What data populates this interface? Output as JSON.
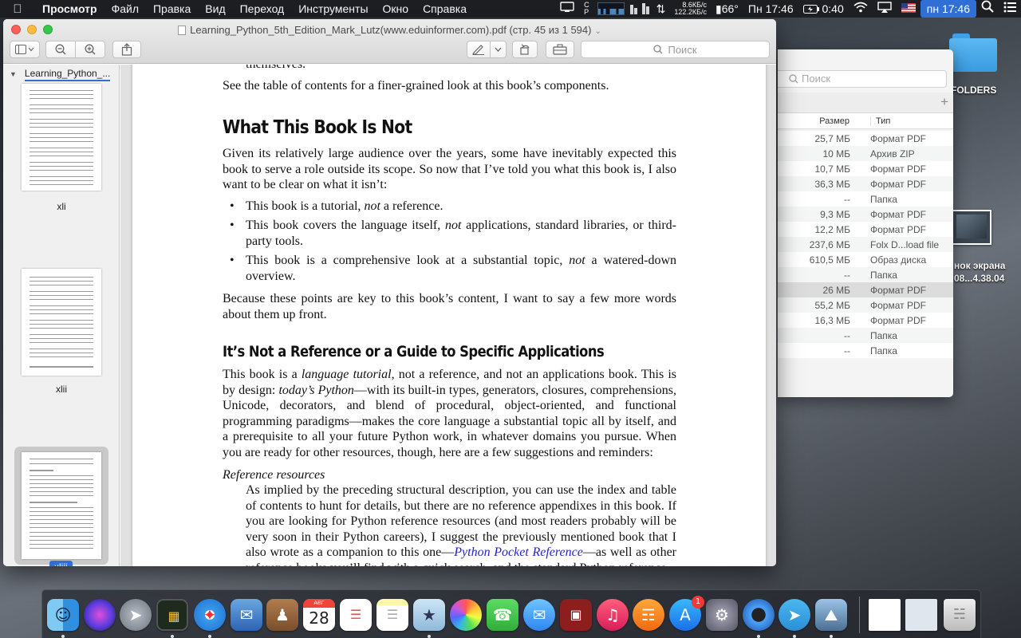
{
  "menubar": {
    "apple_icon": "apple-icon",
    "app_name": "Просмотр",
    "menus": [
      "Файл",
      "Правка",
      "Вид",
      "Переход",
      "Инструменты",
      "Окно",
      "Справка"
    ],
    "net_up": "8.6КБ/с",
    "net_down": "122.2КБ/с",
    "temperature": "66°",
    "clock_short": "Пн 17:46",
    "battery_time": "0:40",
    "clock_highlight": "пн 17:46"
  },
  "preview": {
    "title": "Learning_Python_5th_Edition_Mark_Lutz(www.eduinformer.com).pdf (стр. 45 из 1 594)",
    "search_placeholder": "Поиск",
    "sidebar": {
      "doc_name": "Learning_Python_...",
      "pages": [
        "xli",
        "xlii",
        "xliii"
      ],
      "selected_page": "xliii"
    },
    "page": {
      "top_fragment": "themselves.",
      "intro": "See the table of contents for a finer-grained look at this book’s components.",
      "h_not": "What This Book Is Not",
      "p_given": "Given its relatively large audience over the years, some have inevitably expected this book to serve a role outside its scope. So now that I’ve told you what this book is, I also want to be clear on what it isn’t:",
      "b1_pre": "This book is a tutorial, ",
      "b1_it": "not",
      "b1_post": " a reference.",
      "b2_pre": "This book covers the language itself, ",
      "b2_it": "not",
      "b2_post": " applications, standard libraries, or third-party tools.",
      "b3_pre": "This book is a comprehensive look at a substantial topic, ",
      "b3_it": "not",
      "b3_post": " a watered-down overview.",
      "p_because": "Because these points are key to this book’s content, I want to say a few more words about them up front.",
      "h_ref": "It’s Not a Reference or a Guide to Specific Applications",
      "p_tut_1": "This book is a ",
      "p_tut_it1": "language tutorial",
      "p_tut_2": ", not a reference, and not an applications book. This is by design: ",
      "p_tut_it2": "today’s Python",
      "p_tut_3": "—with its built-in types, generators, closures, comprehensions, Unicode, decorators, and blend of procedural, object-oriented, and functional programming paradigms—makes the core language a substantial topic all by itself, and a prerequisite to all your future Python work, in whatever domains you pursue. When you are ready for other resources, though, here are a few suggestions and reminders:",
      "ref_term": "Reference resources",
      "ref_1": "As implied by the preceding structural description, you can use the index and table of contents to hunt for details, but there are no reference appendixes in this book. If you are looking for Python reference resources (and most readers probably will be very soon in their Python careers), I suggest the previously mentioned book that I also wrote as a companion to this one—",
      "ref_link": "Python Pocket Reference",
      "ref_2": "—as well as other reference books you’ll find with a quick search, and the standard Python reference"
    }
  },
  "finder": {
    "search_placeholder": "Поиск",
    "col_size": "Размер",
    "col_type": "Тип",
    "rows": [
      {
        "size": "25,7 МБ",
        "type": "Формат PDF"
      },
      {
        "size": "10 МБ",
        "type": "Архив ZIP"
      },
      {
        "size": "10,7 МБ",
        "type": "Формат PDF"
      },
      {
        "size": "36,3 МБ",
        "type": "Формат PDF"
      },
      {
        "size": "--",
        "type": "Папка"
      },
      {
        "size": "9,3 МБ",
        "type": "Формат PDF"
      },
      {
        "size": "12,2 МБ",
        "type": "Формат PDF"
      },
      {
        "size": "237,6 МБ",
        "type": "Folx D...load file"
      },
      {
        "size": "610,5 МБ",
        "type": "Образ диска"
      },
      {
        "size": "--",
        "type": "Папка"
      },
      {
        "size": "26 МБ",
        "type": "Формат PDF"
      },
      {
        "size": "55,2 МБ",
        "type": "Формат PDF"
      },
      {
        "size": "16,3 МБ",
        "type": "Формат PDF"
      },
      {
        "size": "--",
        "type": "Папка"
      },
      {
        "size": "--",
        "type": "Папка"
      }
    ]
  },
  "desktop": {
    "folder_label": "FOLDERS",
    "shot_label_1": "нок экрана",
    "shot_label_2": "08...4.38.04"
  },
  "dock": {
    "calendar_month": "АВГ",
    "calendar_day": "28",
    "appstore_badge": "1"
  }
}
